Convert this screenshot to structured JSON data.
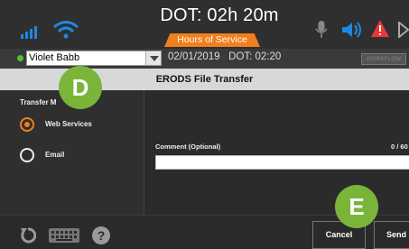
{
  "status": {
    "dot_title": "DOT: 02h 20m",
    "hos_tab": "Hours of Service",
    "icons": [
      "signal-icon",
      "wifi-icon",
      "microphone-icon",
      "speaker-icon",
      "alert-icon",
      "more-icon"
    ],
    "colors": {
      "accent": "#f07f1d",
      "signal": "#1e88e5",
      "alert": "#e53935"
    }
  },
  "driver": {
    "name": "Violet Babb",
    "info": "02/01/2019   DOT: 02:20",
    "workflow_label": "WORKFLOW",
    "status_color": "#52c234"
  },
  "header": {
    "title": "ERODS File Transfer"
  },
  "transfer": {
    "label": "Transfer M",
    "options": [
      {
        "label": "Web Services",
        "selected": true
      },
      {
        "label": "Email",
        "selected": false
      }
    ]
  },
  "comment": {
    "label": "Comment (Optional)",
    "count": "0 / 60",
    "value": ""
  },
  "bottom": {
    "cancel_label": "Cancel",
    "send_label": "Send",
    "help_glyph": "?"
  },
  "callouts": {
    "d": "D",
    "e": "E",
    "color": "#7ab53a"
  }
}
